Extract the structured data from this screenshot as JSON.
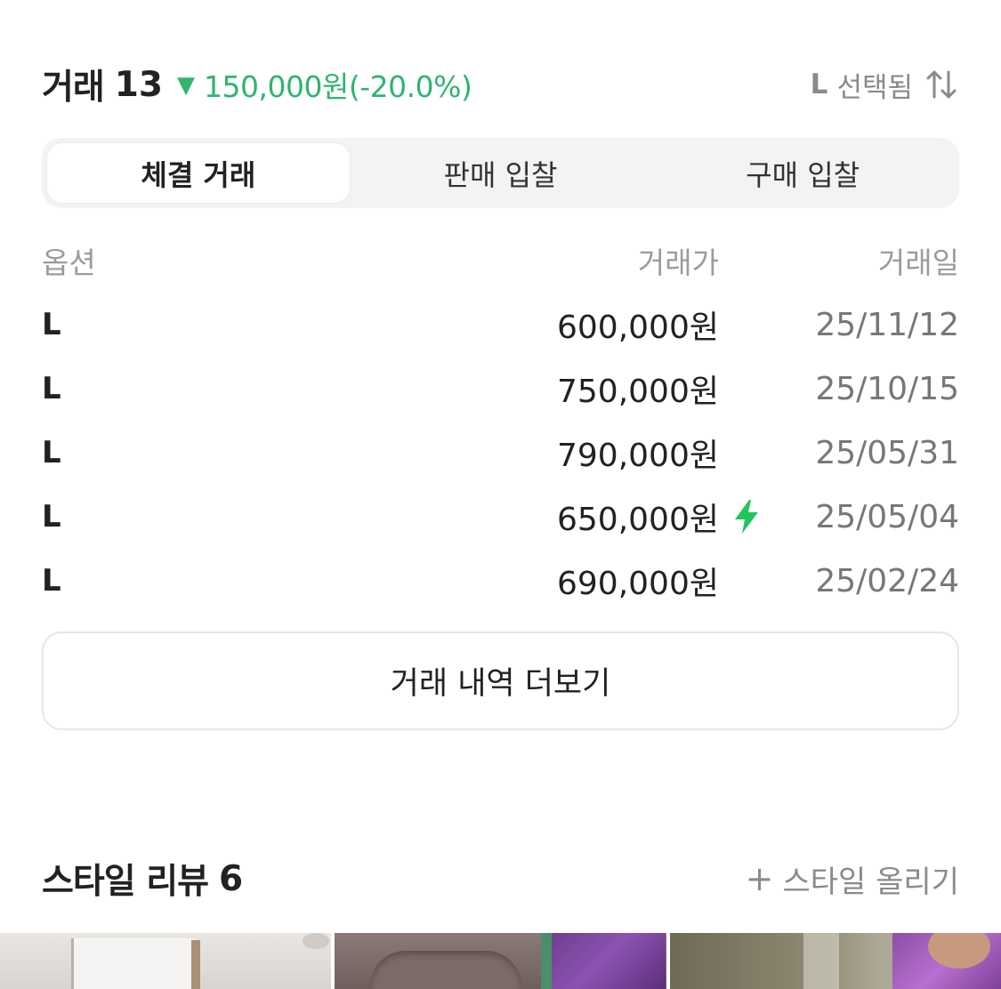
{
  "trade_header": {
    "title": "거래",
    "count": "13",
    "change_arrow": "▼",
    "change": "150,000원(-20.0%)",
    "option": "L",
    "selected": "선택됨",
    "sort_icon": "sort-arrows-icon",
    "colors": {
      "down": "#31b46e",
      "muted": "#8a8a8a"
    }
  },
  "tabs": [
    {
      "label": "체결 거래",
      "active": true
    },
    {
      "label": "판매 입찰",
      "active": false
    },
    {
      "label": "구매 입찰",
      "active": false
    }
  ],
  "table": {
    "headers": {
      "option": "옵션",
      "price": "거래가",
      "date": "거래일"
    },
    "rows": [
      {
        "option": "L",
        "price": "600,000원",
        "date": "25/11/12",
        "flash": false
      },
      {
        "option": "L",
        "price": "750,000원",
        "date": "25/10/15",
        "flash": false
      },
      {
        "option": "L",
        "price": "790,000원",
        "date": "25/05/31",
        "flash": false
      },
      {
        "option": "L",
        "price": "650,000원",
        "date": "25/05/04",
        "flash": true
      },
      {
        "option": "L",
        "price": "690,000원",
        "date": "25/02/24",
        "flash": false
      }
    ],
    "flash_color": "#22c55e"
  },
  "more_button": {
    "label": "거래 내역 더보기"
  },
  "style_review": {
    "title": "스타일 리뷰",
    "count": "6",
    "upload_plus": "+",
    "upload_label": "스타일 올리기"
  }
}
